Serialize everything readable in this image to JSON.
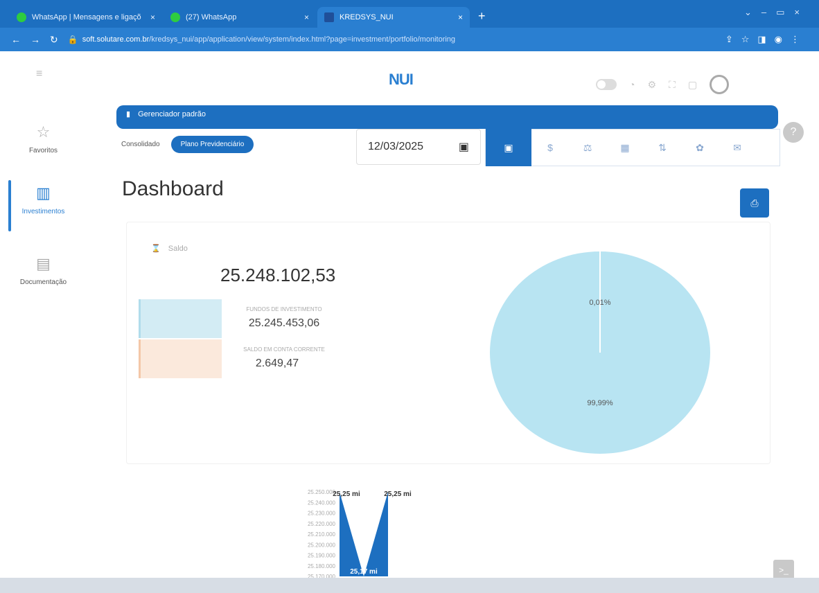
{
  "browser": {
    "tabs": [
      {
        "title": "WhatsApp | Mensagens e ligaçõ",
        "active": false
      },
      {
        "title": "(27) WhatsApp",
        "active": false
      },
      {
        "title": "KREDSYS_NUI",
        "active": true
      }
    ],
    "url_host": "soft.solutare.com.br",
    "url_path": "/kredsys_nui/app/application/view/system/index.html?page=investment/portfolio/monitoring"
  },
  "header": {
    "logo": "NUI"
  },
  "banner": {
    "text": "Gerenciador padrão"
  },
  "sidebar": {
    "items": [
      {
        "label": "Favoritos",
        "icon": "star-icon"
      },
      {
        "label": "Investimentos",
        "icon": "chart-icon",
        "active": true
      },
      {
        "label": "Documentação",
        "icon": "document-icon"
      }
    ]
  },
  "toolbar": {
    "segments": [
      "Consolidado",
      "Plano Previdenciário"
    ],
    "selected_segment": "Plano Previdenciário",
    "date": "12/03/2025"
  },
  "page": {
    "title": "Dashboard"
  },
  "summary": {
    "saldo_label": "Saldo",
    "saldo_value": "25.248.102,53",
    "rows": [
      {
        "label": "FUNDOS DE INVESTIMENTO",
        "value": "25.245.453,06"
      },
      {
        "label": "SALDO EM CONTA CORRENTE",
        "value": "2.649,47"
      }
    ]
  },
  "colors": {
    "primary": "#1d6fc0",
    "pie_fill": "#b8e4f2",
    "fund_bar": "#d3ecf4",
    "cash_bar": "#fbe9dc"
  },
  "chart_data": [
    {
      "type": "pie",
      "labels_shown": [
        "0,01%",
        "99,99%"
      ],
      "values": [
        0.01,
        99.99
      ]
    },
    {
      "type": "bar",
      "y_ticks": [
        "25.250.000",
        "25.240.000",
        "25.230.000",
        "25.220.000",
        "25.210.000",
        "25.200.000",
        "25.190.000",
        "25.180.000",
        "25.170.000"
      ],
      "data_labels": [
        "25,25 mi",
        "25,25 mi",
        "25,17 mi"
      ],
      "values": [
        25250000,
        25170000,
        25250000
      ],
      "ylim": [
        25170000,
        25250000
      ]
    }
  ]
}
